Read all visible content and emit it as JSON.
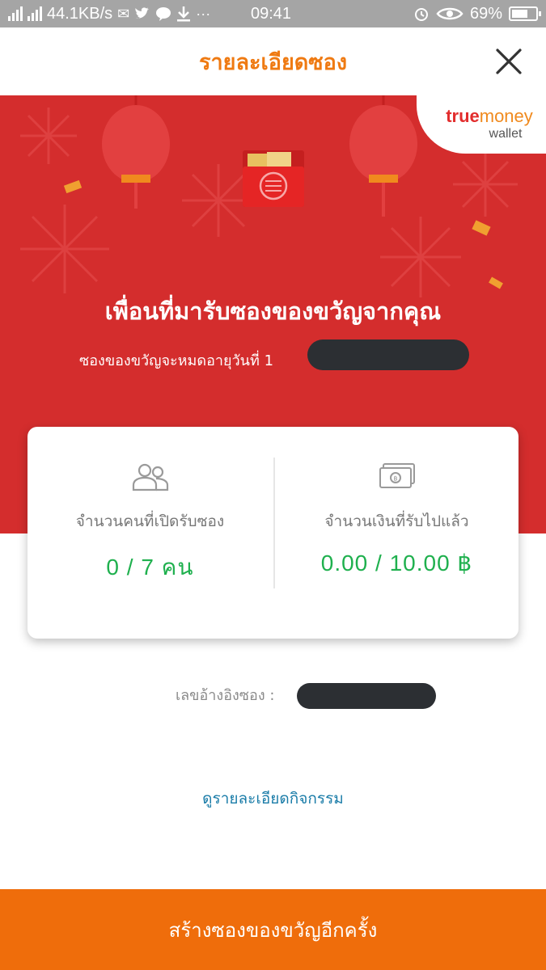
{
  "status_bar": {
    "network": "4G",
    "speed": "44.1KB/s",
    "time": "09:41",
    "battery": "69%",
    "battery_level": 0.69,
    "icons": [
      "mail-icon",
      "twitter-icon",
      "line-icon",
      "download-icon",
      "more-icon",
      "alarm-icon",
      "eye-icon",
      "battery-icon"
    ]
  },
  "header": {
    "title": "รายละเอียดซอง",
    "close_icon": "close-icon"
  },
  "banner": {
    "brand_true": "true",
    "brand_money": "money",
    "brand_wallet": "wallet",
    "title": "เพื่อนที่มารับซองของขวัญจากคุณ",
    "expiry_text": "ซองของขวัญจะหมดอายุวันที่ 1"
  },
  "stats": {
    "people_label": "จำนวนคนที่เปิดรับซอง",
    "people_value": "0 / 7 คน",
    "money_label": "จำนวนเงินที่รับไปแล้ว",
    "money_value": "0.00 / 10.00 ฿"
  },
  "reference": {
    "label": "เลขอ้างอิงซอง :"
  },
  "activity_link": "ดูรายละเอียดกิจกรรม",
  "create_button": "สร้างซองของขวัญอีกครั้ง",
  "colors": {
    "accent_orange": "#ef7a12",
    "banner_red": "#d42d2d",
    "value_green": "#1fb04e",
    "link_blue": "#1a7ca8",
    "button_orange": "#ef6d0b"
  }
}
